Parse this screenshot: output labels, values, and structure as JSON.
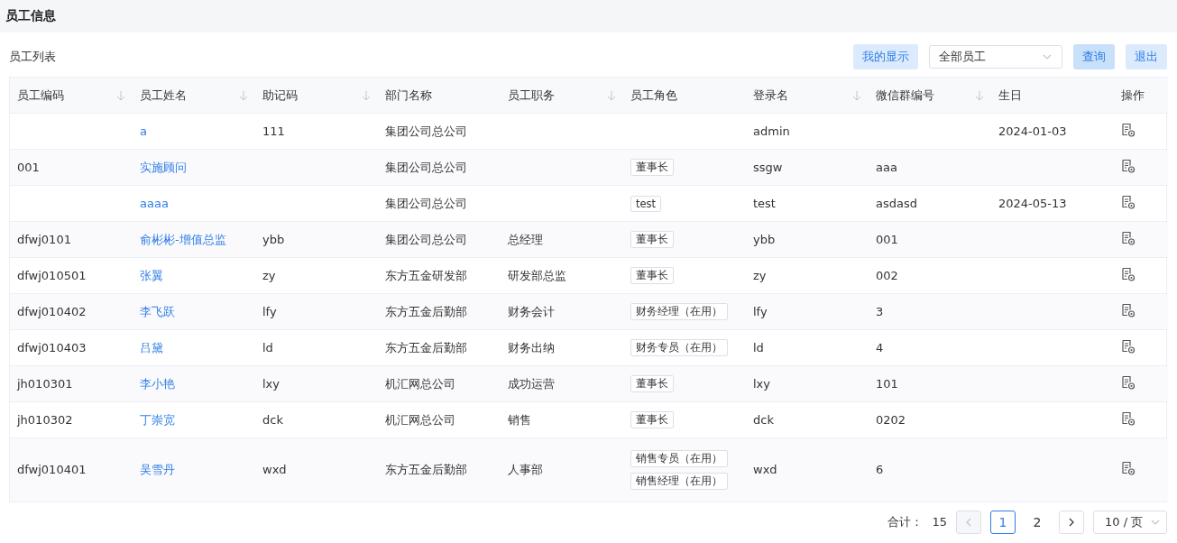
{
  "header": {
    "title": "员工信息"
  },
  "toolbar": {
    "title": "员工列表",
    "buttons": [
      {
        "label": "我的显示",
        "kind": "light"
      }
    ],
    "filter": {
      "value": "全部员工"
    },
    "actions": [
      {
        "label": "查询",
        "kind": "primary"
      },
      {
        "label": "退出",
        "kind": "light"
      }
    ]
  },
  "table": {
    "columns": [
      {
        "label": "员工编码",
        "sortable": true
      },
      {
        "label": "员工姓名",
        "sortable": true
      },
      {
        "label": "助记码",
        "sortable": true
      },
      {
        "label": "部门名称",
        "sortable": false
      },
      {
        "label": "员工职务",
        "sortable": true
      },
      {
        "label": "员工角色",
        "sortable": false
      },
      {
        "label": "登录名",
        "sortable": true
      },
      {
        "label": "微信群编号",
        "sortable": true
      },
      {
        "label": "生日",
        "sortable": false
      },
      {
        "label": "操作",
        "sortable": false
      }
    ],
    "rows": [
      {
        "code": "",
        "name": "a",
        "mnemonic": "111",
        "dept": "集团公司总公司",
        "title": "",
        "roles": [],
        "login": "admin",
        "wechat": "",
        "birthday": "2024-01-03"
      },
      {
        "code": "001",
        "name": "实施顾问",
        "mnemonic": "",
        "dept": "集团公司总公司",
        "title": "",
        "roles": [
          "董事长"
        ],
        "login": "ssgw",
        "wechat": "aaa",
        "birthday": ""
      },
      {
        "code": "",
        "name": "aaaa",
        "mnemonic": "",
        "dept": "集团公司总公司",
        "title": "",
        "roles": [
          "test"
        ],
        "login": "test",
        "wechat": "asdasd",
        "birthday": "2024-05-13"
      },
      {
        "code": "dfwj0101",
        "name": "俞彬彬-增值总监",
        "mnemonic": "ybb",
        "dept": "集团公司总公司",
        "title": "总经理",
        "roles": [
          "董事长"
        ],
        "login": "ybb",
        "wechat": "001",
        "birthday": ""
      },
      {
        "code": "dfwj010501",
        "name": "张翼",
        "mnemonic": "zy",
        "dept": "东方五金研发部",
        "title": "研发部总监",
        "roles": [
          "董事长"
        ],
        "login": "zy",
        "wechat": "002",
        "birthday": ""
      },
      {
        "code": "dfwj010402",
        "name": "李飞跃",
        "mnemonic": "lfy",
        "dept": "东方五金后勤部",
        "title": "财务会计",
        "roles": [
          "财务经理（在用）"
        ],
        "login": "lfy",
        "wechat": "3",
        "birthday": ""
      },
      {
        "code": "dfwj010403",
        "name": "吕黛",
        "mnemonic": "ld",
        "dept": "东方五金后勤部",
        "title": "财务出纳",
        "roles": [
          "财务专员（在用）"
        ],
        "login": "ld",
        "wechat": "4",
        "birthday": ""
      },
      {
        "code": "jh010301",
        "name": "李小艳",
        "mnemonic": "lxy",
        "dept": "机汇网总公司",
        "title": "成功运营",
        "roles": [
          "董事长"
        ],
        "login": "lxy",
        "wechat": "101",
        "birthday": ""
      },
      {
        "code": "jh010302",
        "name": "丁崇宽",
        "mnemonic": "dck",
        "dept": "机汇网总公司",
        "title": "销售",
        "roles": [
          "董事长"
        ],
        "login": "dck",
        "wechat": "0202",
        "birthday": ""
      },
      {
        "code": "dfwj010401",
        "name": "吴雪丹",
        "mnemonic": "wxd",
        "dept": "东方五金后勤部",
        "title": "人事部",
        "roles": [
          "销售专员（在用）",
          "销售经理（在用）"
        ],
        "login": "wxd",
        "wechat": "6",
        "birthday": ""
      }
    ]
  },
  "pagination": {
    "total_label": "合计：",
    "total": "15",
    "prev_disabled": true,
    "pages": [
      {
        "label": "1",
        "selected": true
      },
      {
        "label": "2",
        "selected": false
      }
    ],
    "next_disabled": false,
    "page_size": "10 / 页"
  }
}
